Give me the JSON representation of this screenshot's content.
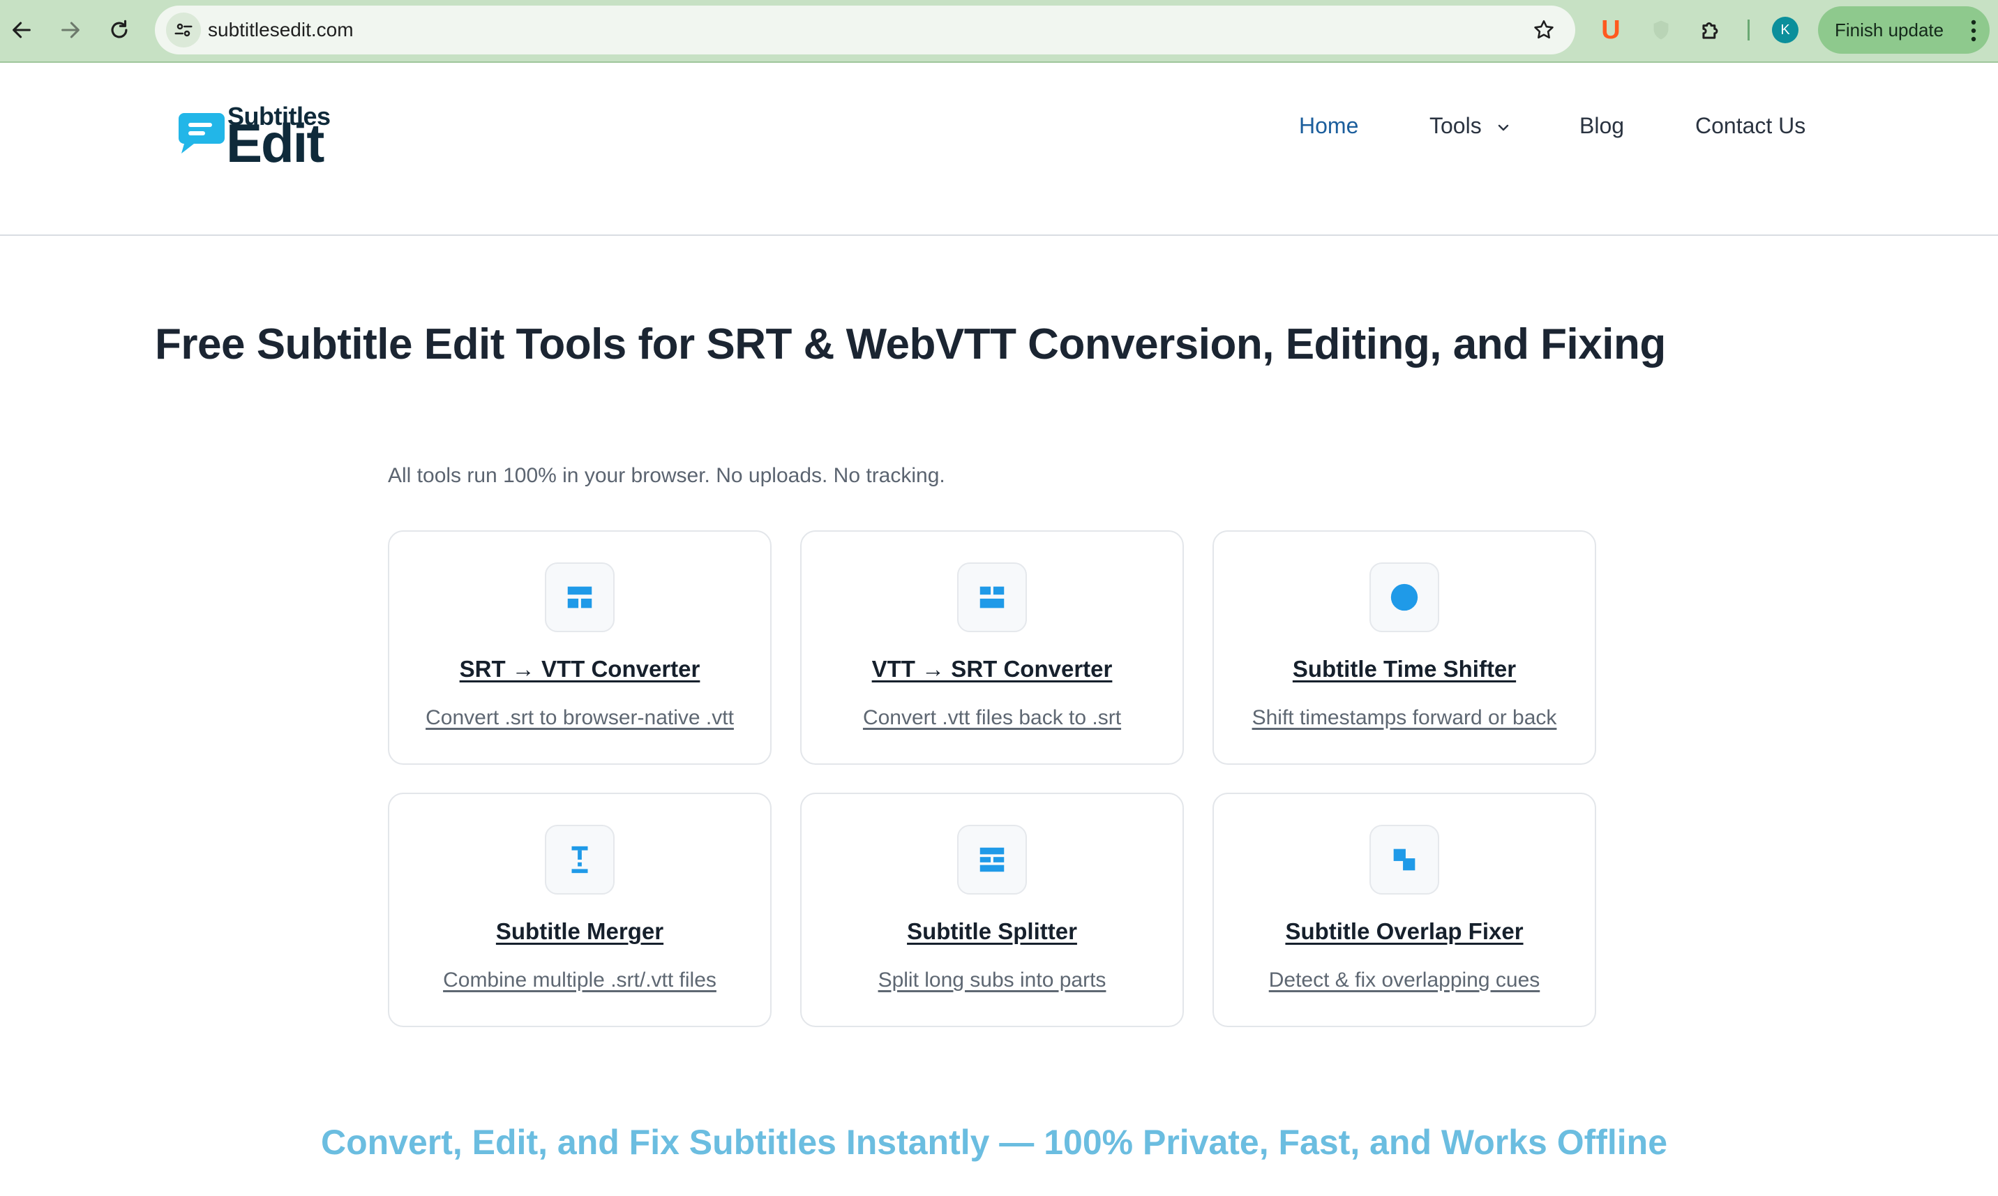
{
  "browser": {
    "url": "subtitlesedit.com",
    "finish_update_label": "Finish update",
    "profile_initial": "K",
    "extension_u_label": "U"
  },
  "site": {
    "logo": {
      "line1": "Subtitles",
      "line2": "Edit"
    },
    "nav": {
      "home": "Home",
      "tools": "Tools",
      "blog": "Blog",
      "contact": "Contact Us"
    }
  },
  "main": {
    "title": "Free Subtitle Edit Tools for SRT & WebVTT Conversion, Editing, and Fixing",
    "subtitle": "All tools run 100% in your browser. No uploads. No tracking.",
    "cards": [
      {
        "title": "SRT → VTT Converter",
        "desc": "Convert .srt to browser-native .vtt",
        "icon": "table-layout-icon"
      },
      {
        "title": "VTT → SRT Converter",
        "desc": "Convert .vtt files back to .srt",
        "icon": "grid-blocks-icon"
      },
      {
        "title": "Subtitle Time Shifter",
        "desc": "Shift timestamps forward or back",
        "icon": "circle-icon"
      },
      {
        "title": "Subtitle Merger",
        "desc": "Combine multiple .srt/.vtt files",
        "icon": "merge-icon"
      },
      {
        "title": "Subtitle Splitter",
        "desc": "Split long subs into parts",
        "icon": "split-rows-icon"
      },
      {
        "title": "Subtitle Overlap Fixer",
        "desc": "Detect & fix overlapping cues",
        "icon": "overlap-squares-icon"
      }
    ],
    "tagline": "Convert, Edit, and Fix Subtitles Instantly — 100% Private, Fast, and Works Offline"
  },
  "colors": {
    "chrome_bg": "#c7e1c4",
    "accent_blue": "#1f9ae8",
    "nav_active": "#1b5e9c",
    "tagline": "#6bbde0"
  }
}
